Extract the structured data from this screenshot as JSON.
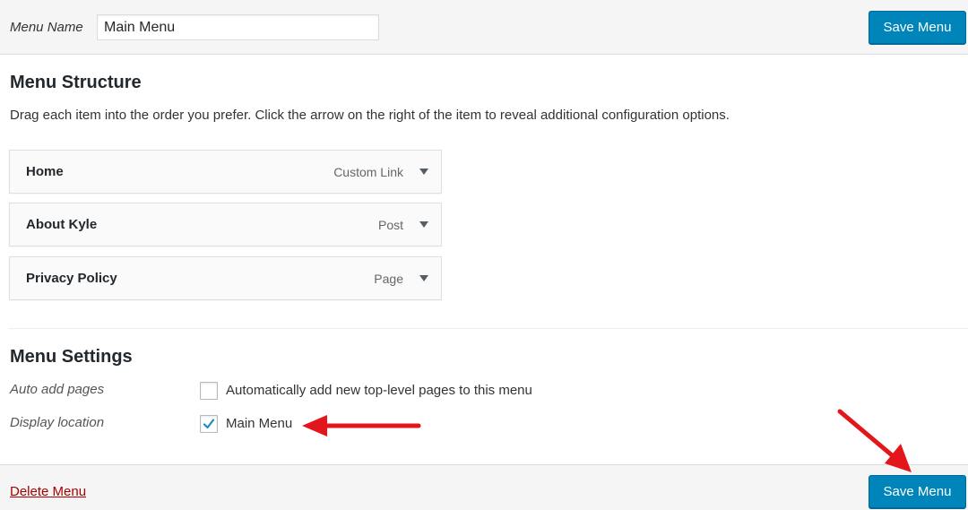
{
  "header": {
    "menu_name_label": "Menu Name",
    "menu_name_value": "Main Menu",
    "save_label": "Save Menu"
  },
  "structure": {
    "title": "Menu Structure",
    "instructions": "Drag each item into the order you prefer. Click the arrow on the right of the item to reveal additional configuration options.",
    "items": [
      {
        "title": "Home",
        "type": "Custom Link"
      },
      {
        "title": "About Kyle",
        "type": "Post"
      },
      {
        "title": "Privacy Policy",
        "type": "Page"
      }
    ]
  },
  "settings": {
    "title": "Menu Settings",
    "auto_add_label": "Auto add pages",
    "auto_add_option": "Automatically add new top-level pages to this menu",
    "auto_add_checked": false,
    "display_location_label": "Display location",
    "display_location_option": "Main Menu",
    "display_location_checked": true
  },
  "footer": {
    "delete_label": "Delete Menu",
    "save_label": "Save Menu"
  },
  "colors": {
    "primary_button": "#0085ba",
    "delete_link": "#aa0000",
    "annotation_arrow": "#e3161b",
    "checkmark": "#1e8cbe"
  },
  "icons": {
    "item_toggle": "triangle-down-icon",
    "checkbox_check": "checkmark-icon",
    "annotation": "red-arrow-icon"
  }
}
